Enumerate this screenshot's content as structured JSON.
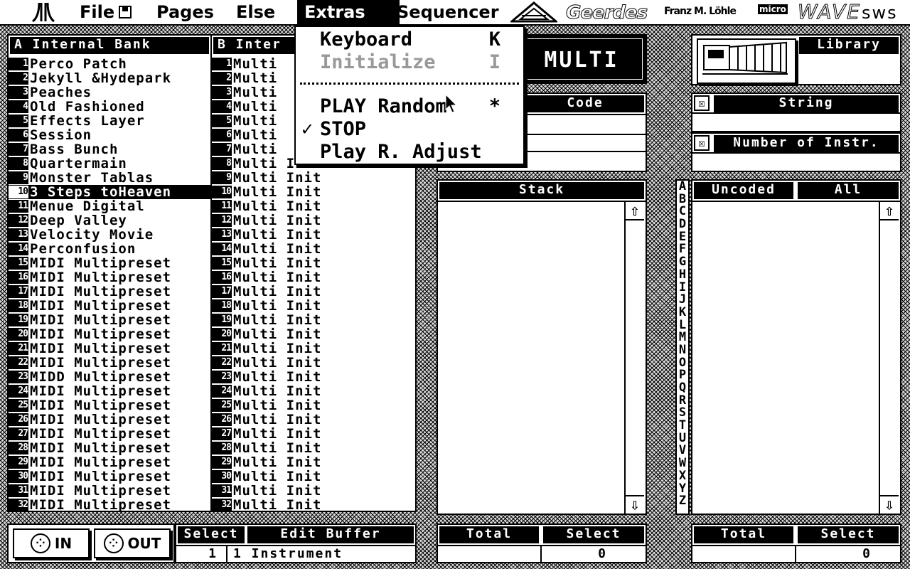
{
  "menubar": {
    "atari_logo": "atari-fuji-icon",
    "items": [
      {
        "label": "File"
      },
      {
        "label": "Pages"
      },
      {
        "label": "Else"
      },
      {
        "label": "Extras"
      },
      {
        "label": "Sequencer"
      }
    ],
    "brand_geerdes": "Geerdes",
    "brand_author": "Franz M. Löhle",
    "brand_micro": "micro",
    "brand_wave": "WAVE",
    "brand_sws": "sws"
  },
  "extras_menu": {
    "items": [
      {
        "label": "Keyboard",
        "key": "K",
        "checked": "",
        "disabled": false
      },
      {
        "label": "Initialize",
        "key": "I",
        "checked": "",
        "disabled": true
      },
      {
        "label": "PLAY Random",
        "key": "*",
        "checked": "",
        "disabled": false
      },
      {
        "label": "STOP",
        "key": "",
        "checked": "✓",
        "disabled": false
      },
      {
        "label": "Play R. Adjust",
        "key": "",
        "checked": "",
        "disabled": false
      }
    ]
  },
  "bank_a": {
    "title": "A Internal Bank",
    "selected_index": 9,
    "items": [
      {
        "n": "1",
        "name": "Perco Patch"
      },
      {
        "n": "2",
        "name": "Jekyll &Hydepark"
      },
      {
        "n": "3",
        "name": "Peaches"
      },
      {
        "n": "4",
        "name": "Old Fashioned"
      },
      {
        "n": "5",
        "name": "Effects Layer"
      },
      {
        "n": "6",
        "name": "Session"
      },
      {
        "n": "7",
        "name": "Bass Bunch"
      },
      {
        "n": "8",
        "name": "Quartermain"
      },
      {
        "n": "9",
        "name": "Monster Tablas"
      },
      {
        "n": "10",
        "name": "3 Steps toHeaven"
      },
      {
        "n": "11",
        "name": "Menue Digital"
      },
      {
        "n": "12",
        "name": "Deep Valley"
      },
      {
        "n": "13",
        "name": "Velocity Movie"
      },
      {
        "n": "14",
        "name": "Perconfusion"
      },
      {
        "n": "15",
        "name": "MIDI Multipreset"
      },
      {
        "n": "16",
        "name": "MIDI Multipreset"
      },
      {
        "n": "17",
        "name": "MIDI Multipreset"
      },
      {
        "n": "18",
        "name": "MIDI Multipreset"
      },
      {
        "n": "19",
        "name": "MIDI Multipreset"
      },
      {
        "n": "20",
        "name": "MIDI Multipreset"
      },
      {
        "n": "21",
        "name": "MIDI Multipreset"
      },
      {
        "n": "22",
        "name": "MIDI Multipreset"
      },
      {
        "n": "23",
        "name": "MIDD Multipreset"
      },
      {
        "n": "24",
        "name": "MIDI Multipreset"
      },
      {
        "n": "25",
        "name": "MIDI Multipreset"
      },
      {
        "n": "26",
        "name": "MIDI Multipreset"
      },
      {
        "n": "27",
        "name": "MIDI Multipreset"
      },
      {
        "n": "28",
        "name": "MIDI Multipreset"
      },
      {
        "n": "29",
        "name": "MIDI Multipreset"
      },
      {
        "n": "30",
        "name": "MIDI Multipreset"
      },
      {
        "n": "31",
        "name": "MIDI Multipreset"
      },
      {
        "n": "32",
        "name": "MIDI Multipreset"
      }
    ]
  },
  "bank_b": {
    "title": "B Inter",
    "items": [
      {
        "n": "1",
        "name": "Multi"
      },
      {
        "n": "2",
        "name": "Multi"
      },
      {
        "n": "3",
        "name": "Multi"
      },
      {
        "n": "4",
        "name": "Multi"
      },
      {
        "n": "5",
        "name": "Multi"
      },
      {
        "n": "6",
        "name": "Multi"
      },
      {
        "n": "7",
        "name": "Multi"
      },
      {
        "n": "8",
        "name": "Multi Init"
      },
      {
        "n": "9",
        "name": "Multi Init"
      },
      {
        "n": "10",
        "name": "Multi Init"
      },
      {
        "n": "11",
        "name": "Multi Init"
      },
      {
        "n": "12",
        "name": "Multi Init"
      },
      {
        "n": "13",
        "name": "Multi Init"
      },
      {
        "n": "14",
        "name": "Multi Init"
      },
      {
        "n": "15",
        "name": "Multi Init"
      },
      {
        "n": "16",
        "name": "Multi Init"
      },
      {
        "n": "17",
        "name": "Multi Init"
      },
      {
        "n": "18",
        "name": "Multi Init"
      },
      {
        "n": "19",
        "name": "Multi Init"
      },
      {
        "n": "20",
        "name": "Multi Init"
      },
      {
        "n": "21",
        "name": "Multi Init"
      },
      {
        "n": "22",
        "name": "Multi Init"
      },
      {
        "n": "23",
        "name": "Multi Init"
      },
      {
        "n": "24",
        "name": "Multi Init"
      },
      {
        "n": "25",
        "name": "Multi Init"
      },
      {
        "n": "26",
        "name": "Multi Init"
      },
      {
        "n": "27",
        "name": "Multi Init"
      },
      {
        "n": "28",
        "name": "Multi Init"
      },
      {
        "n": "29",
        "name": "Multi Init"
      },
      {
        "n": "30",
        "name": "Multi Init"
      },
      {
        "n": "31",
        "name": "Multi Init"
      },
      {
        "n": "32",
        "name": "Multi Init"
      }
    ]
  },
  "mode_label": "MULTI",
  "code": {
    "label": "Code"
  },
  "stack": {
    "title": "Stack",
    "up": "⇧",
    "down": "⇩"
  },
  "library": {
    "label": "Library",
    "image_icon": "disk-library-icon"
  },
  "string_filter": {
    "label": "String",
    "checkbox": "☒"
  },
  "instr_filter": {
    "label": "Number of Instr.",
    "checkbox": "☒"
  },
  "letters": [
    "A",
    "B",
    "C",
    "D",
    "E",
    "F",
    "G",
    "H",
    "I",
    "J",
    "K",
    "L",
    "M",
    "N",
    "O",
    "P",
    "Q",
    "R",
    "S",
    "T",
    "U",
    "V",
    "W",
    "X",
    "Y",
    "Z"
  ],
  "library_list": {
    "tab_uncoded": "Uncoded",
    "tab_all": "All",
    "up": "⇧",
    "down": "⇩"
  },
  "midi": {
    "in_label": "IN",
    "out_label": "OUT"
  },
  "edit_buffer": {
    "select_label": "Select",
    "title": "Edit Buffer",
    "select_value": "1",
    "value": "1 Instrument"
  },
  "mid_footer": {
    "total_label": "Total",
    "select_label": "Select",
    "total_value": "",
    "select_value": "0"
  },
  "right_footer": {
    "total_label": "Total",
    "select_label": "Select",
    "total_value": "",
    "select_value": "0"
  }
}
